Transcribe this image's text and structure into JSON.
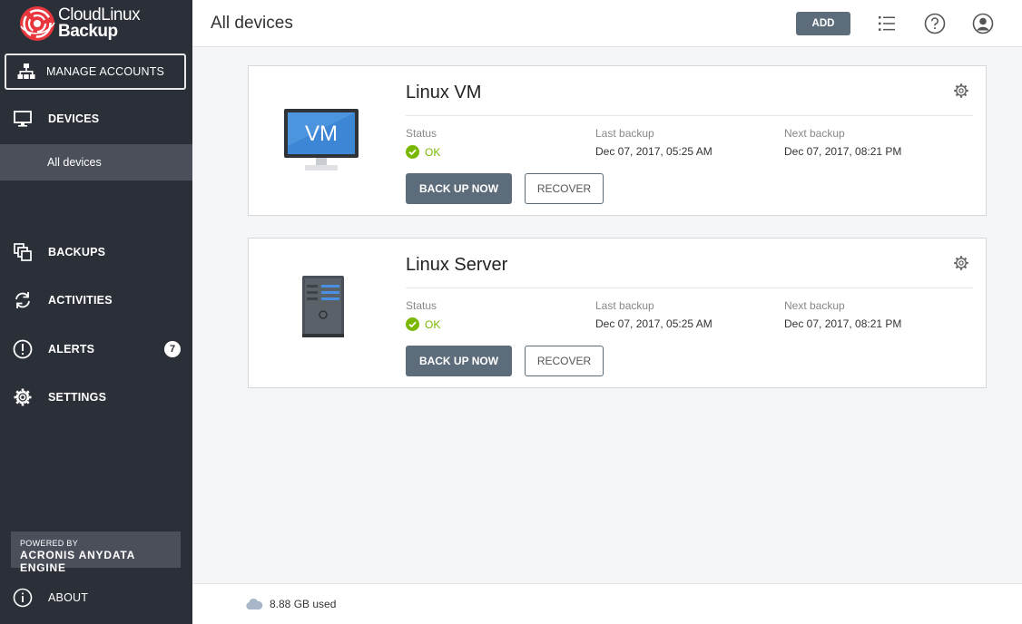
{
  "brand": {
    "name_line1": "CloudLinux",
    "name_line2": "Backup",
    "accent": "#e8383d"
  },
  "sidebar": {
    "manage_accounts": "MANAGE ACCOUNTS",
    "devices": "DEVICES",
    "all_devices": "All devices",
    "backups": "BACKUPS",
    "activities": "ACTIVITIES",
    "alerts": "ALERTS",
    "alerts_count": "7",
    "settings": "SETTINGS",
    "powered_by": "POWERED BY",
    "engine": "ACRONIS ANYDATA ENGINE",
    "about": "ABOUT"
  },
  "header": {
    "title": "All devices",
    "add_label": "ADD"
  },
  "devices": [
    {
      "name": "Linux VM",
      "icon": "vm-monitor-icon",
      "icon_text": "VM",
      "status_label": "Status",
      "status": "OK",
      "last_backup_label": "Last backup",
      "last_backup": "Dec 07, 2017, 05:25 AM",
      "next_backup_label": "Next backup",
      "next_backup": "Dec 07, 2017, 08:21 PM",
      "backup_now": "BACK UP NOW",
      "recover": "RECOVER"
    },
    {
      "name": "Linux Server",
      "icon": "server-tower-icon",
      "status_label": "Status",
      "status": "OK",
      "last_backup_label": "Last backup",
      "last_backup": "Dec 07, 2017, 05:25 AM",
      "next_backup_label": "Next backup",
      "next_backup": "Dec 07, 2017, 08:21 PM",
      "backup_now": "BACK UP NOW",
      "recover": "RECOVER"
    }
  ],
  "footer": {
    "storage_used": "8.88 GB used"
  },
  "colors": {
    "sidebar_bg": "#2b2f38",
    "sidebar_active": "#4a4f5a",
    "primary_button": "#5d6c7b",
    "ok_green": "#7ab800",
    "page_bg": "#f4f5f7"
  }
}
